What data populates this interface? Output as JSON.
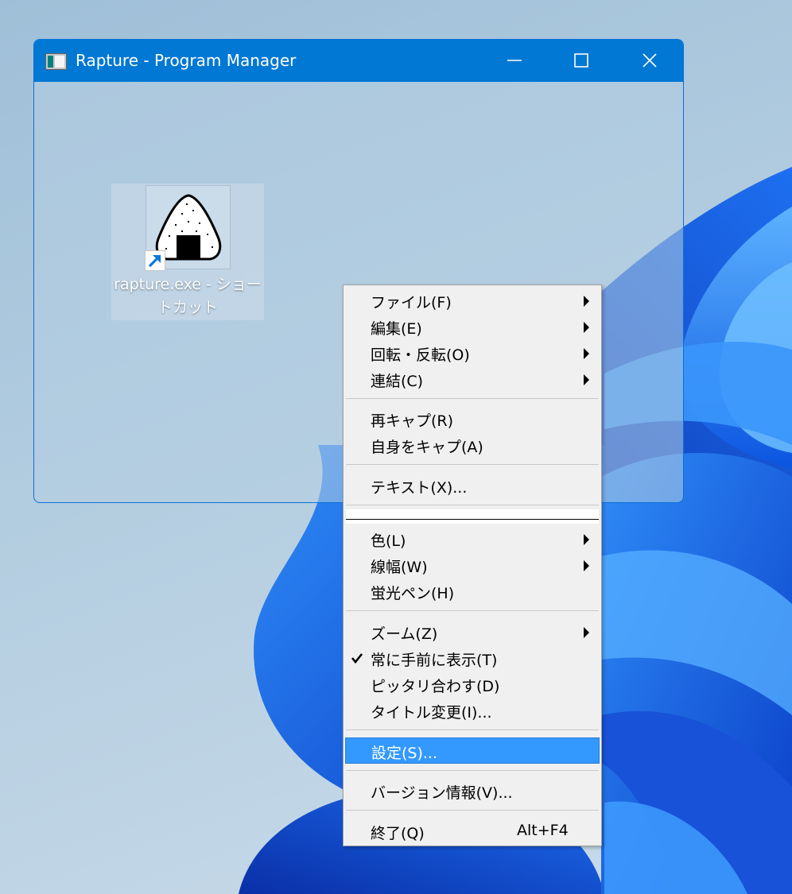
{
  "window": {
    "title": "Rapture - Program Manager",
    "accent_color": "#0078d4"
  },
  "desktop": {
    "shortcut": {
      "label": "rapture.exe - ショートカット",
      "icon": "onigiri-icon"
    }
  },
  "menu": {
    "items": [
      {
        "label": "ファイル(F)",
        "submenu": true
      },
      {
        "label": "編集(E)",
        "submenu": true
      },
      {
        "label": "回転・反転(O)",
        "submenu": true
      },
      {
        "label": "連結(C)",
        "submenu": true
      },
      {
        "label": "再キャプ(R)"
      },
      {
        "label": "自身をキャプ(A)"
      },
      {
        "label": "テキスト(X)..."
      },
      {
        "label": "色(L)",
        "submenu": true
      },
      {
        "label": "線幅(W)",
        "submenu": true
      },
      {
        "label": "蛍光ペン(H)"
      },
      {
        "label": "ズーム(Z)",
        "submenu": true
      },
      {
        "label": "常に手前に表示(T)",
        "checked": true
      },
      {
        "label": "ピッタリ合わす(D)"
      },
      {
        "label": "タイトル変更(I)..."
      },
      {
        "label": "設定(S)...",
        "highlighted": true
      },
      {
        "label": "バージョン情報(V)..."
      },
      {
        "label": "終了(Q)",
        "shortcut": "Alt+F4"
      }
    ],
    "highlight_color": "#3399ff"
  }
}
